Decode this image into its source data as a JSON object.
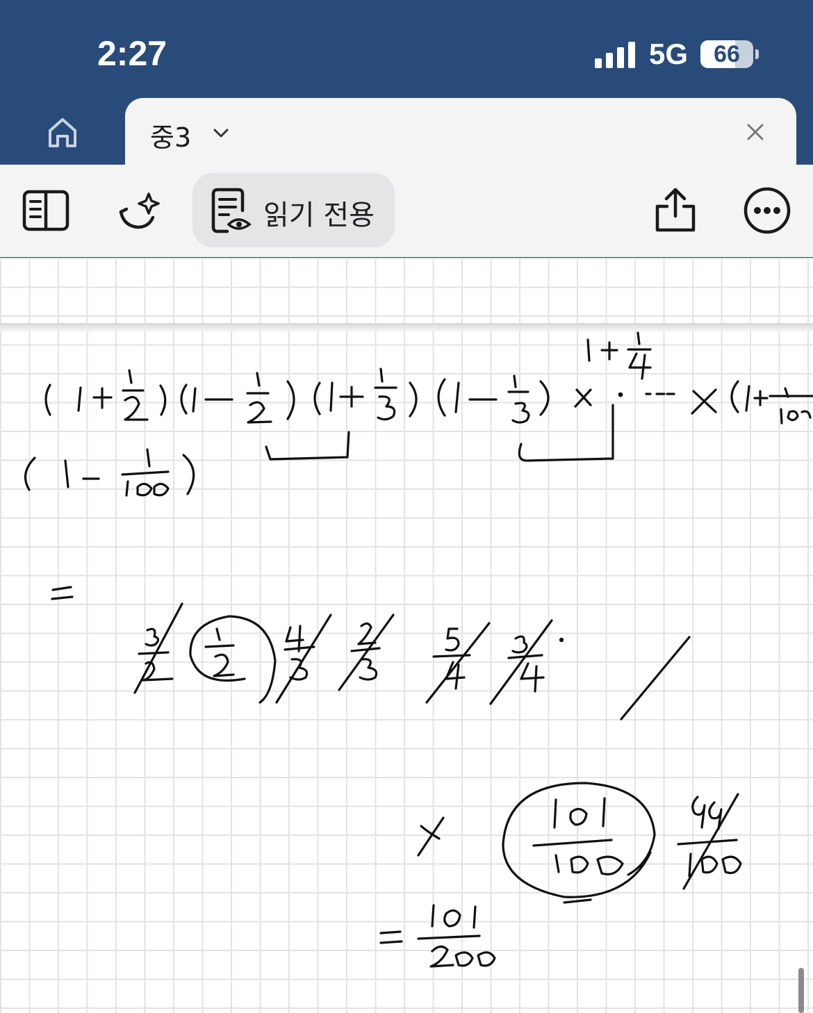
{
  "status": {
    "time": "2:27",
    "network": "5G",
    "battery_percent": "66",
    "battery_level": 0.66
  },
  "tabs": {
    "home_icon": "home-icon",
    "current_title": "중3",
    "chevron_icon": "chevron-down-icon",
    "close_icon": "close-icon"
  },
  "toolbar": {
    "sidebar_icon": "sidebar-panel-icon",
    "ai_icon": "sparkle-assistant-icon",
    "readonly_icon": "document-view-icon",
    "readonly_label": "읽기 전용",
    "share_icon": "share-icon",
    "more_icon": "more-options-icon"
  },
  "colors": {
    "header": "#294b7a",
    "toolbar": "#f4f4f5",
    "grid": "#e3e3e6",
    "ink": "#111111"
  }
}
